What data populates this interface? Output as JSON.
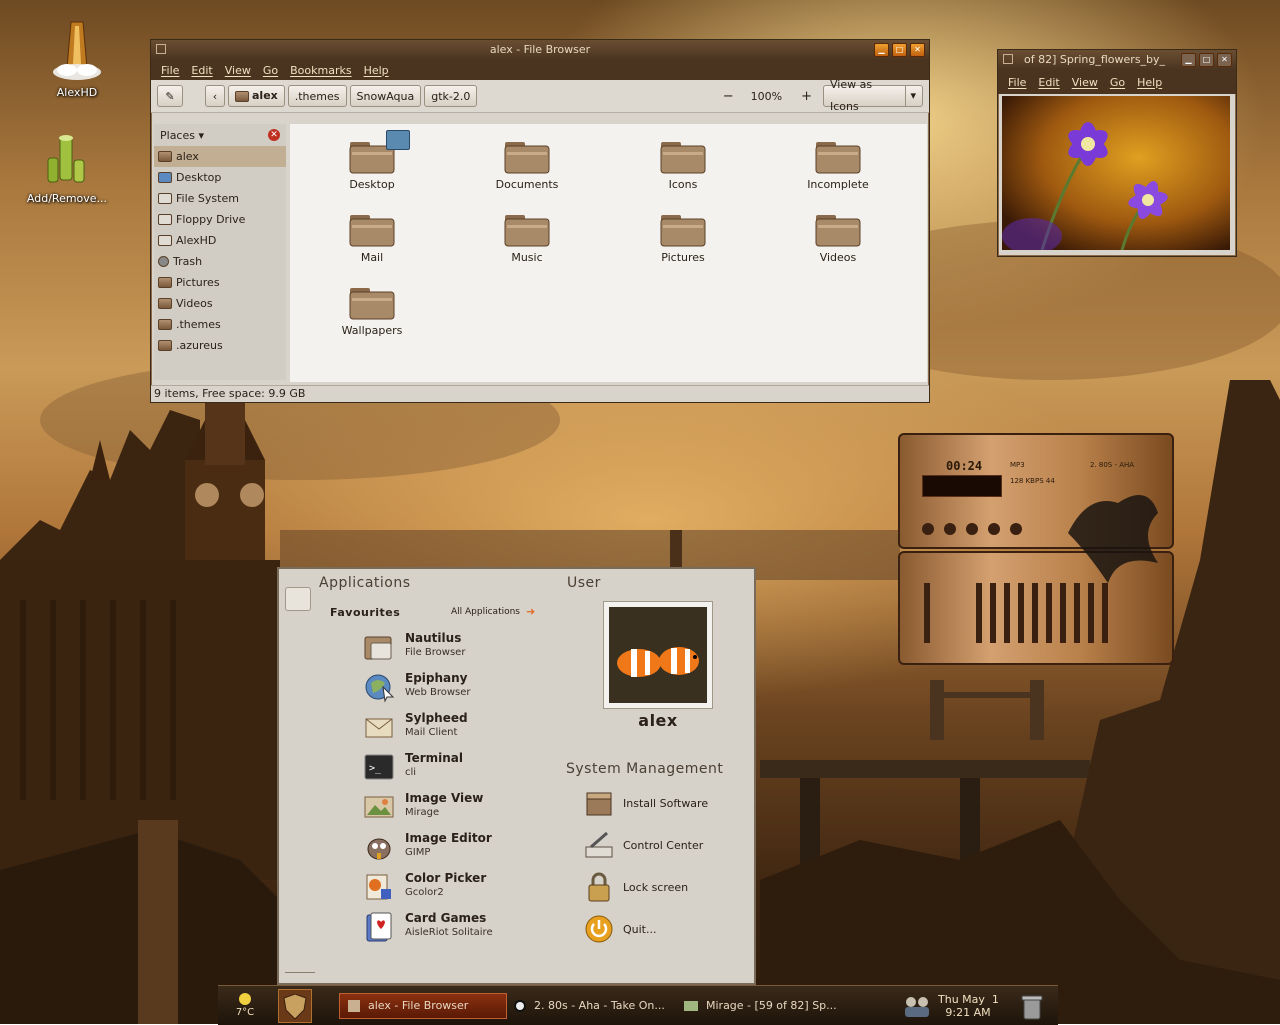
{
  "desktop": {
    "icons": [
      {
        "label": "AlexHD",
        "icon": "harddrive-tower-icon"
      },
      {
        "label": "Add/Remove...",
        "icon": "bamboo-install-icon"
      }
    ]
  },
  "file_browser": {
    "title": "alex - File Browser",
    "menu": [
      "File",
      "Edit",
      "View",
      "Go",
      "Bookmarks",
      "Help"
    ],
    "path_buttons": [
      "alex",
      ".themes",
      "SnowAqua",
      "gtk-2.0"
    ],
    "zoom_out": "−",
    "zoom": "100%",
    "zoom_in": "+",
    "view_mode": "View as Icons",
    "places_label": "Places ▾",
    "places": [
      "alex",
      "Desktop",
      "File System",
      "Floppy Drive",
      "AlexHD",
      "Trash",
      "Pictures",
      "Videos",
      ".themes",
      ".azureus"
    ],
    "folders": [
      "Desktop",
      "Documents",
      "Icons",
      "Incomplete",
      "Mail",
      "Music",
      "Pictures",
      "Videos",
      "Wallpapers"
    ],
    "status": "9 items, Free space: 9.9 GB"
  },
  "image_viewer": {
    "title": "of 82] Spring_flowers_by_",
    "menu": [
      "File",
      "Edit",
      "View",
      "Go",
      "Help"
    ]
  },
  "media_player": {
    "time": "00:24",
    "format": "MP3",
    "info": "128 KBPS 44",
    "track": "2. 80S - AHA"
  },
  "app_menu": {
    "applications_title": "Applications",
    "favourites_label": "Favourites",
    "all_apps_label": "All Applications",
    "user_title": "User",
    "user_name": "alex",
    "system_title": "System Management",
    "apps": [
      {
        "name": "Nautilus",
        "desc": "File Browser",
        "icon": "file-manager-icon"
      },
      {
        "name": "Epiphany",
        "desc": "Web Browser",
        "icon": "web-browser-icon"
      },
      {
        "name": "Sylpheed",
        "desc": "Mail Client",
        "icon": "mail-client-icon"
      },
      {
        "name": "Terminal",
        "desc": "cli",
        "icon": "terminal-icon"
      },
      {
        "name": "Image View",
        "desc": "Mirage",
        "icon": "image-viewer-icon"
      },
      {
        "name": "Image Editor",
        "desc": "GIMP",
        "icon": "gimp-icon"
      },
      {
        "name": "Color Picker",
        "desc": "Gcolor2",
        "icon": "color-picker-icon"
      },
      {
        "name": "Card Games",
        "desc": "AisleRiot Solitaire",
        "icon": "card-games-icon"
      }
    ],
    "system": [
      {
        "label": "Install Software",
        "icon": "install-software-icon"
      },
      {
        "label": "Control Center",
        "icon": "control-center-icon"
      },
      {
        "label": "Lock screen",
        "icon": "padlock-icon"
      },
      {
        "label": "Quit...",
        "icon": "power-icon"
      }
    ]
  },
  "taskbar": {
    "weather": "7°C",
    "tasks": [
      "alex - File Browser",
      "2. 80s - Aha - Take On...",
      "Mirage - [59 of 82] Sp..."
    ],
    "date": "Thu May  1",
    "time": "9:21 AM"
  }
}
